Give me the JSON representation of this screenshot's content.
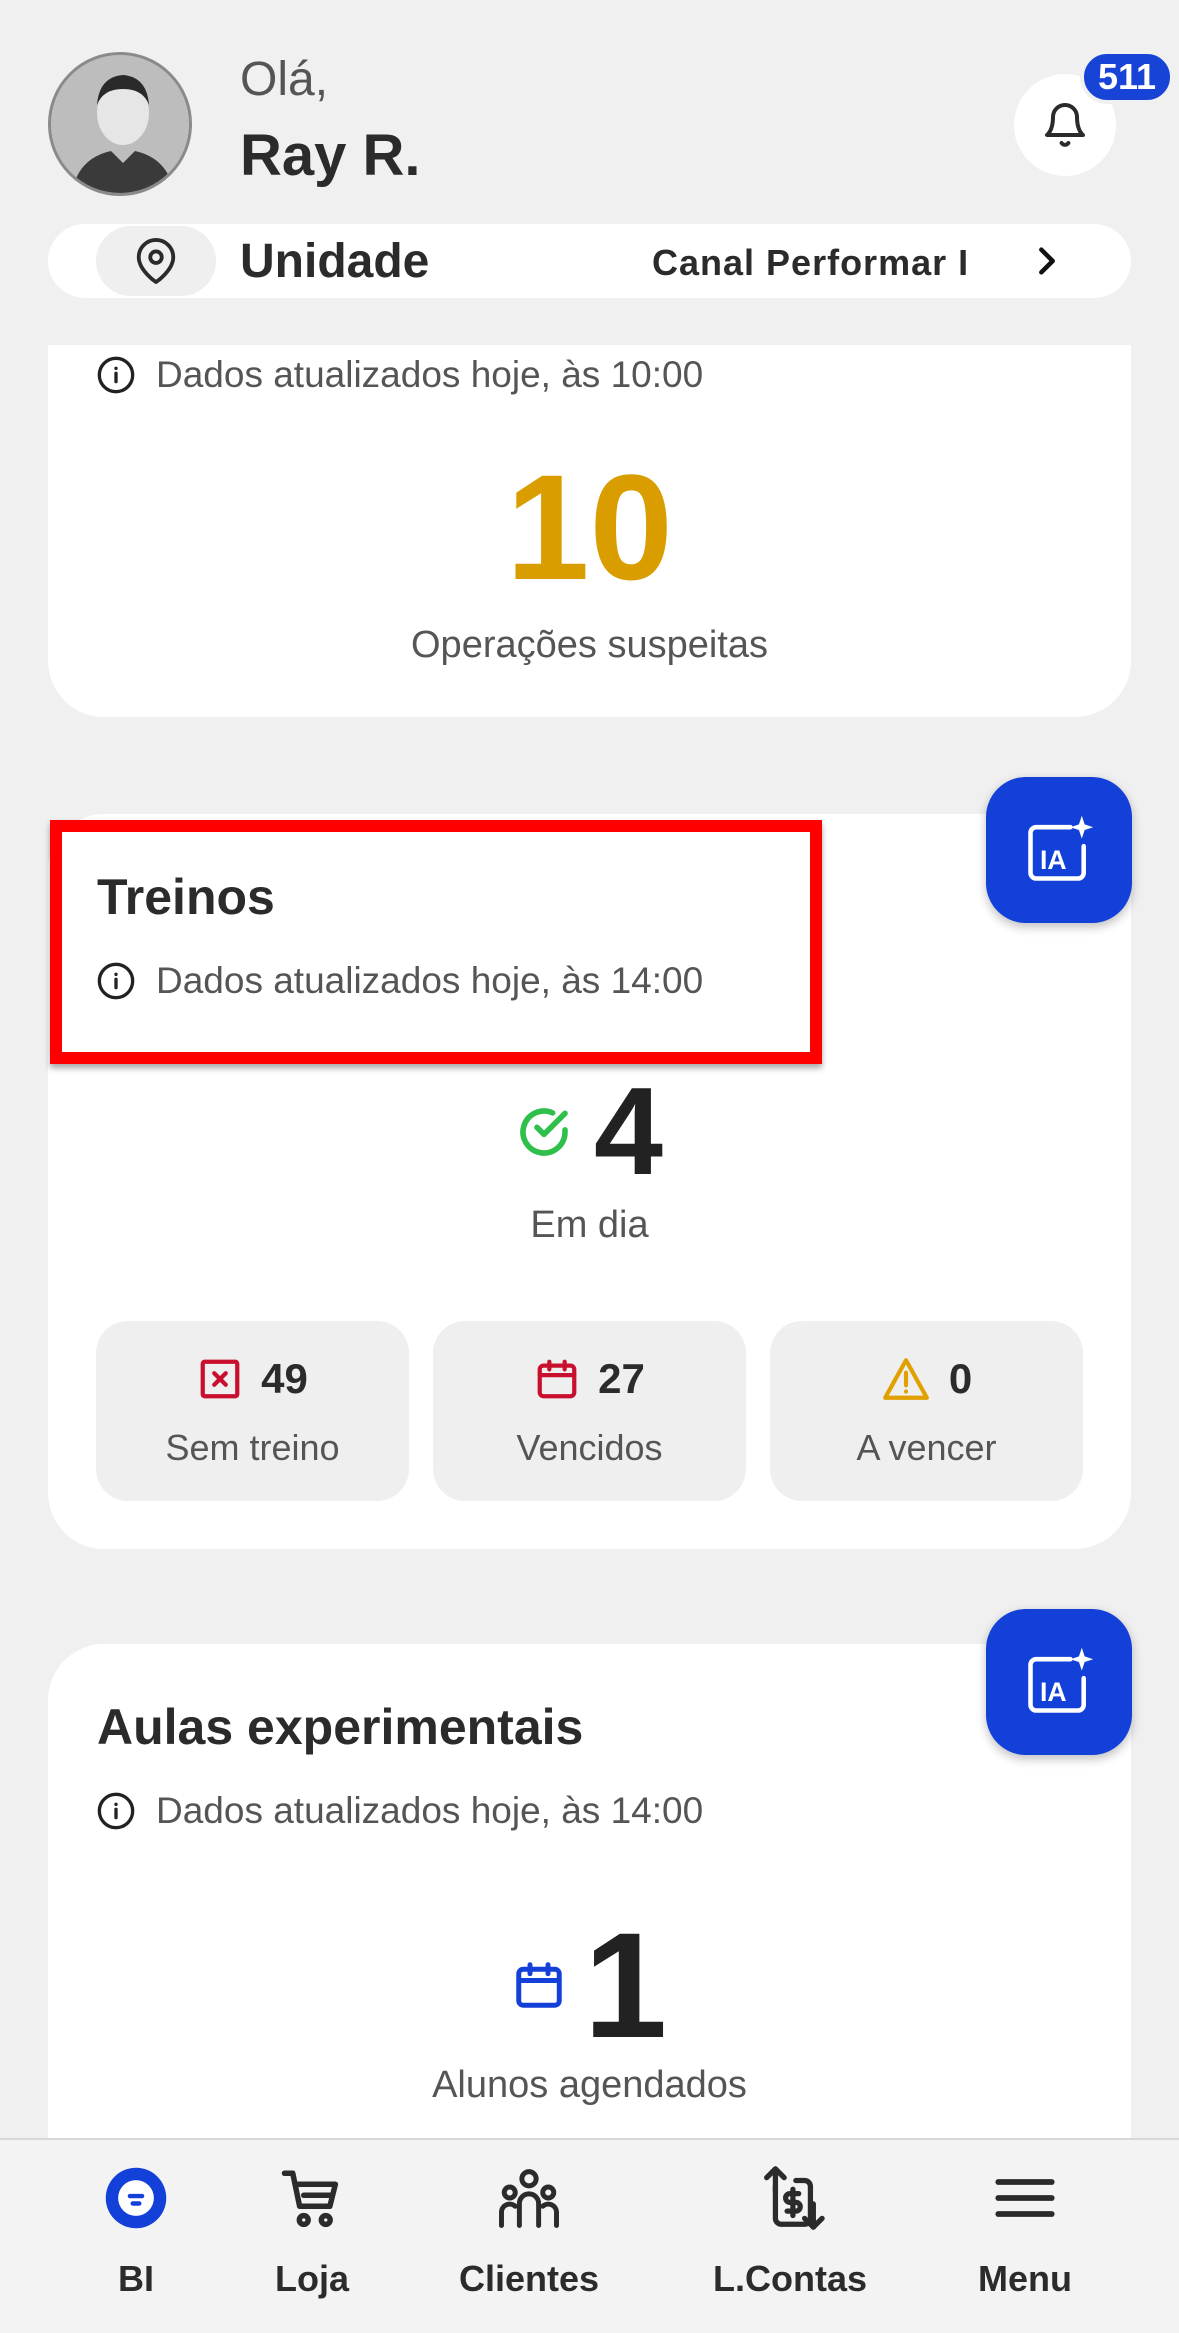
{
  "header": {
    "greeting": "Olá,",
    "user_name": "Ray R.",
    "notifications_count": "511"
  },
  "unit": {
    "label": "Unidade",
    "value": "Canal Performar I"
  },
  "card_suspicious": {
    "updated": "Dados atualizados hoje, às 10:00",
    "value": "10",
    "caption": "Operações suspeitas",
    "value_color": "#d99d00"
  },
  "card_treinos": {
    "title": "Treinos",
    "updated": "Dados atualizados hoje, às 14:00",
    "main_value": "4",
    "main_caption": "Em dia",
    "ia_label": "IA",
    "tiles": [
      {
        "value": "49",
        "label": "Sem treino",
        "icon": "x-square-icon",
        "color": "#c8102e"
      },
      {
        "value": "27",
        "label": "Vencidos",
        "icon": "calendar-icon",
        "color": "#c8102e"
      },
      {
        "value": "0",
        "label": "A vencer",
        "icon": "warning-icon",
        "color": "#e0a000"
      }
    ]
  },
  "card_aulas": {
    "title": "Aulas experimentais",
    "updated": "Dados atualizados hoje, às 14:00",
    "main_value": "1",
    "main_caption": "Alunos agendados",
    "ia_label": "IA"
  },
  "bottom_nav": [
    {
      "label": "BI",
      "icon": "bi-icon"
    },
    {
      "label": "Loja",
      "icon": "cart-icon"
    },
    {
      "label": "Clientes",
      "icon": "people-icon"
    },
    {
      "label": "L.Contas",
      "icon": "money-transfer-icon"
    },
    {
      "label": "Menu",
      "icon": "hamburger-icon"
    }
  ],
  "colors": {
    "accent": "#1340d8",
    "highlight": "#ff0000",
    "success": "#2fbf4a"
  }
}
